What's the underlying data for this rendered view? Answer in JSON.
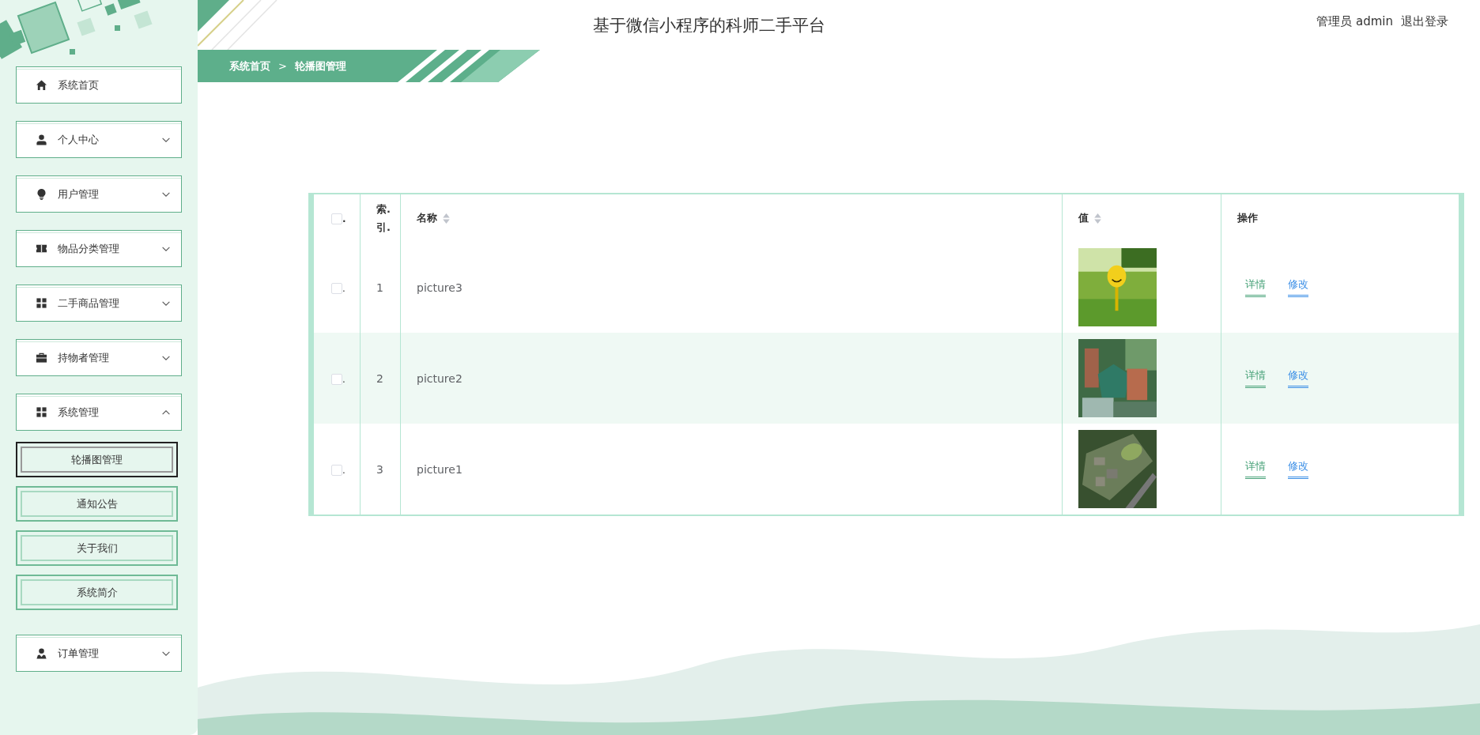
{
  "header": {
    "title": "基于微信小程序的科师二手平台",
    "user_role": "管理员",
    "username": "admin",
    "logout": "退出登录"
  },
  "breadcrumb": {
    "items": [
      "系统首页",
      "轮播图管理"
    ],
    "separator": ">"
  },
  "sidebar": {
    "items": [
      {
        "kind": "link",
        "label": "系统首页"
      },
      {
        "kind": "menu",
        "label": "个人中心",
        "expanded": false
      },
      {
        "kind": "menu",
        "label": "用户管理",
        "expanded": false
      },
      {
        "kind": "menu",
        "label": "物品分类管理",
        "expanded": false
      },
      {
        "kind": "menu",
        "label": "二手商品管理",
        "expanded": false
      },
      {
        "kind": "menu",
        "label": "持物者管理",
        "expanded": false
      },
      {
        "kind": "menu",
        "label": "系统管理",
        "expanded": true,
        "children": [
          {
            "label": "轮播图管理",
            "selected": true
          },
          {
            "label": "通知公告",
            "selected": false
          },
          {
            "label": "关于我们",
            "selected": false
          },
          {
            "label": "系统简介",
            "selected": false
          }
        ]
      },
      {
        "kind": "menu",
        "label": "订单管理",
        "expanded": false
      }
    ]
  },
  "table": {
    "header_checkbox": {
      "checked": false,
      "dot": "."
    },
    "columns": [
      {
        "label": "索.引.",
        "sortable": false
      },
      {
        "label": "名称",
        "sortable": true
      },
      {
        "label": "值",
        "sortable": true
      },
      {
        "label": "操作",
        "sortable": false
      }
    ],
    "rows": [
      {
        "checked": false,
        "dot": ".",
        "index": "1",
        "name": "picture3",
        "value": {
          "kind": "picture"
        },
        "actions": [
          {
            "label": "详情",
            "color": "#4aa37a"
          },
          {
            "label": "修改",
            "color": "#3a8ee6"
          }
        ]
      },
      {
        "checked": false,
        "dot": ".",
        "index": "2",
        "name": "picture2",
        "value": {
          "kind": "picture"
        },
        "actions": [
          {
            "label": "详情",
            "color": "#4aa37a"
          },
          {
            "label": "修改",
            "color": "#3a8ee6"
          }
        ]
      },
      {
        "checked": false,
        "dot": ".",
        "index": "3",
        "name": "picture1",
        "value": {
          "kind": "picture"
        },
        "actions": [
          {
            "label": "详情",
            "color": "#4aa37a"
          },
          {
            "label": "修改",
            "color": "#3a8ee6"
          }
        ]
      }
    ]
  }
}
